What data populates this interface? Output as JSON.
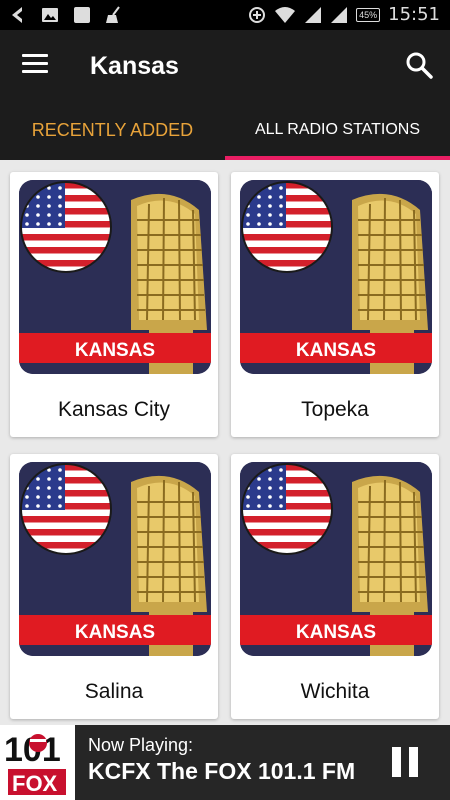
{
  "status_bar": {
    "time": "15:51",
    "battery": "45%",
    "icons": [
      "back-arrow-icon",
      "image-icon",
      "square-icon",
      "broom-icon",
      "data-saver-icon",
      "wifi-icon",
      "signal-icon"
    ]
  },
  "app_bar": {
    "title": "Kansas",
    "menu_icon": "hamburger-menu-icon",
    "search_icon": "search-icon"
  },
  "tabs": [
    {
      "label": "RECENTLY ADDED",
      "color": "#e8a33a"
    },
    {
      "label": "ALL RADIO STATIONS",
      "selected": true,
      "color": "#ffffff",
      "indicator_color": "#e91e63"
    }
  ],
  "stations": [
    {
      "name": "Kansas City",
      "banner": "KANSAS"
    },
    {
      "name": "Topeka",
      "banner": "KANSAS"
    },
    {
      "name": "Salina",
      "banner": "KANSAS"
    },
    {
      "name": "Wichita",
      "banner": "KANSAS"
    }
  ],
  "now_playing": {
    "label": "Now Playing:",
    "title": "KCFX The FOX 101.1 FM",
    "logo_number": "101",
    "logo_text": "FOX",
    "pause_icon": "pause-icon"
  },
  "colors": {
    "accent": "#e91e63",
    "tab_orange": "#e8a33a",
    "banner_red": "#e01b22",
    "app_bar": "#1c1c1c"
  }
}
